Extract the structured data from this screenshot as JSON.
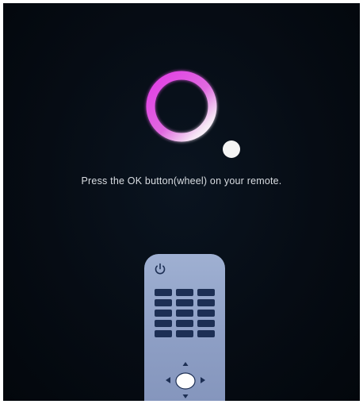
{
  "screen": {
    "instruction": "Press the OK button(wheel) on your remote.",
    "colors": {
      "background": "#050b12",
      "ring_magenta": "#e040e0",
      "ring_white": "#ffffff",
      "remote_body": "#93a4c9",
      "remote_keys": "#1d2f54"
    }
  },
  "loading_indicator": {
    "icon": "loading-ring-icon"
  },
  "remote": {
    "icons": [
      "power-icon",
      "dpad-up-icon",
      "dpad-down-icon",
      "dpad-left-icon",
      "dpad-right-icon",
      "ok-wheel-icon"
    ],
    "keypad_rows": 5,
    "keypad_columns": 3
  }
}
